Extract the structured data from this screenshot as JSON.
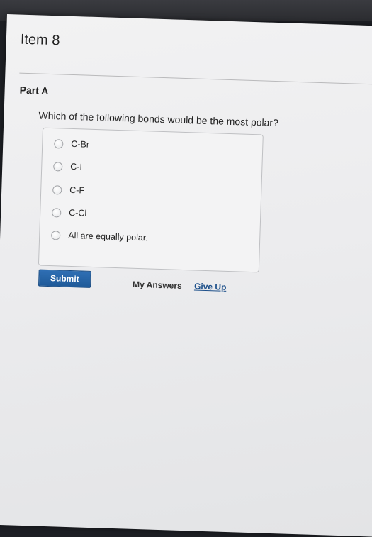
{
  "header": {
    "item_title": "Item 8"
  },
  "part": {
    "label": "Part A",
    "question": "Which of the following bonds would be the most polar?"
  },
  "options": [
    {
      "label": "C-Br"
    },
    {
      "label": "C-I"
    },
    {
      "label": "C-F"
    },
    {
      "label": "C-Cl"
    },
    {
      "label": "All are equally polar."
    }
  ],
  "actions": {
    "submit_label": "Submit",
    "my_answers_label": "My Answers",
    "give_up_label": "Give Up"
  },
  "colors": {
    "submit_button": "#2a66a8",
    "link": "#1c4f8a"
  }
}
